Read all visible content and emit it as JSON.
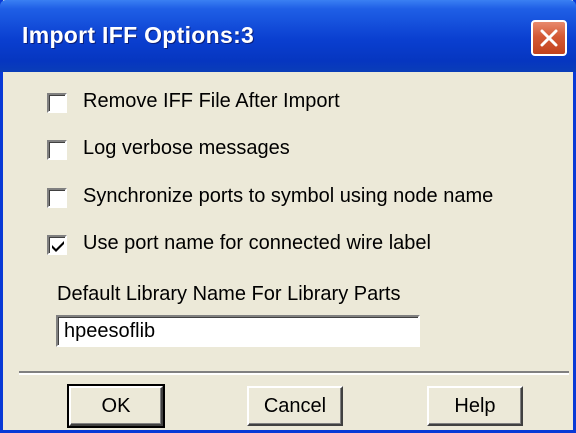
{
  "window": {
    "title": "Import IFF Options:3"
  },
  "options": [
    {
      "label": "Remove IFF File After Import",
      "checked": false
    },
    {
      "label": "Log verbose messages",
      "checked": false
    },
    {
      "label": "Synchronize ports to symbol using node name",
      "checked": false
    },
    {
      "label": "Use port name for connected wire label",
      "checked": true
    }
  ],
  "library": {
    "label": "Default Library Name For Library Parts",
    "value": "hpeesoflib"
  },
  "buttons": {
    "ok": "OK",
    "cancel": "Cancel",
    "help": "Help"
  },
  "colors": {
    "titlebar": "#0a3fd0",
    "close_button": "#d45a36",
    "dialog_background": "#ece9d8"
  },
  "icons": {
    "close": "close-x-icon",
    "check": "checkmark-icon"
  }
}
